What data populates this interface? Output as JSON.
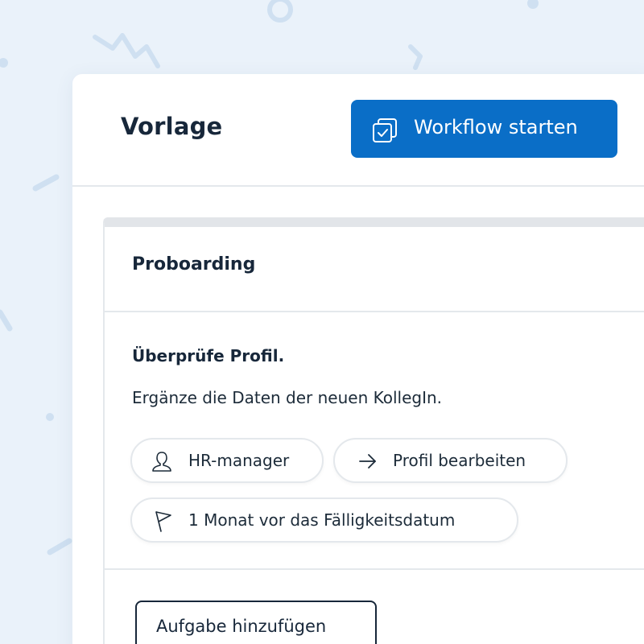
{
  "header": {
    "title": "Vorlage",
    "start_workflow_label": "Workflow starten",
    "start_workflow_icon": "duplicate-check-icon"
  },
  "card": {
    "section_title": "Proboarding",
    "task": {
      "title": "Überprüfe Profil.",
      "description": "Ergänze die Daten der neuen KollegIn.",
      "chips": [
        {
          "icon": "person-icon",
          "label": "HR-manager"
        },
        {
          "icon": "arrow-right-icon",
          "label": "Profil bearbeiten"
        },
        {
          "icon": "flag-icon",
          "label": "1 Monat vor das Fälligkeitsdatum"
        }
      ]
    },
    "add_task_label": "Aufgabe hinzufügen"
  },
  "colors": {
    "background": "#eaf2fa",
    "primary": "#0a6ec7",
    "text": "#17273a",
    "border": "#e4e8ec"
  }
}
